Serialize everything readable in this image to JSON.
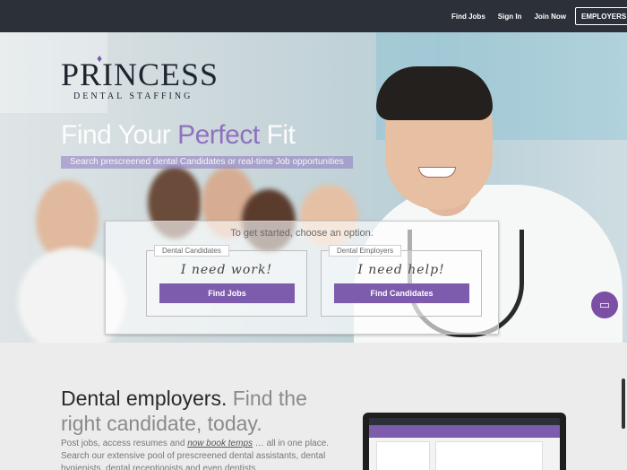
{
  "nav": {
    "find_jobs": "Find Jobs",
    "sign_in": "Sign In",
    "join_now": "Join Now",
    "employers": "EMPLOYERS"
  },
  "brand": {
    "name": "PRINCESS",
    "tagline": "DENTAL STAFFING",
    "accent_color": "#7d5cae",
    "nav_color": "#2c3039"
  },
  "hero": {
    "headline_start": "Find Your ",
    "headline_accent": "Perfect",
    "headline_end": " Fit",
    "subline": "Search prescreened dental Candidates or real-time Job opportunities",
    "chooser_title": "To get started, choose an option.",
    "candidates": {
      "tag": "Dental Candidates",
      "script": "I need work!",
      "button": "Find Jobs"
    },
    "employers": {
      "tag": "Dental Employers",
      "script": "I need help!",
      "button": "Find Candidates"
    }
  },
  "employers_section": {
    "title_strong": "Dental employers.",
    "title_muted_1": " Find the",
    "title_muted_2": "right candidate, today.",
    "body_start": "Post jobs, access resumes and ",
    "body_link": "now book temps",
    "body_end": " … all in one place. Search our extensive pool of prescreened dental assistants, dental hygienists, dental receptionists and even dentists."
  },
  "chat": {
    "icon": "chat-icon"
  }
}
